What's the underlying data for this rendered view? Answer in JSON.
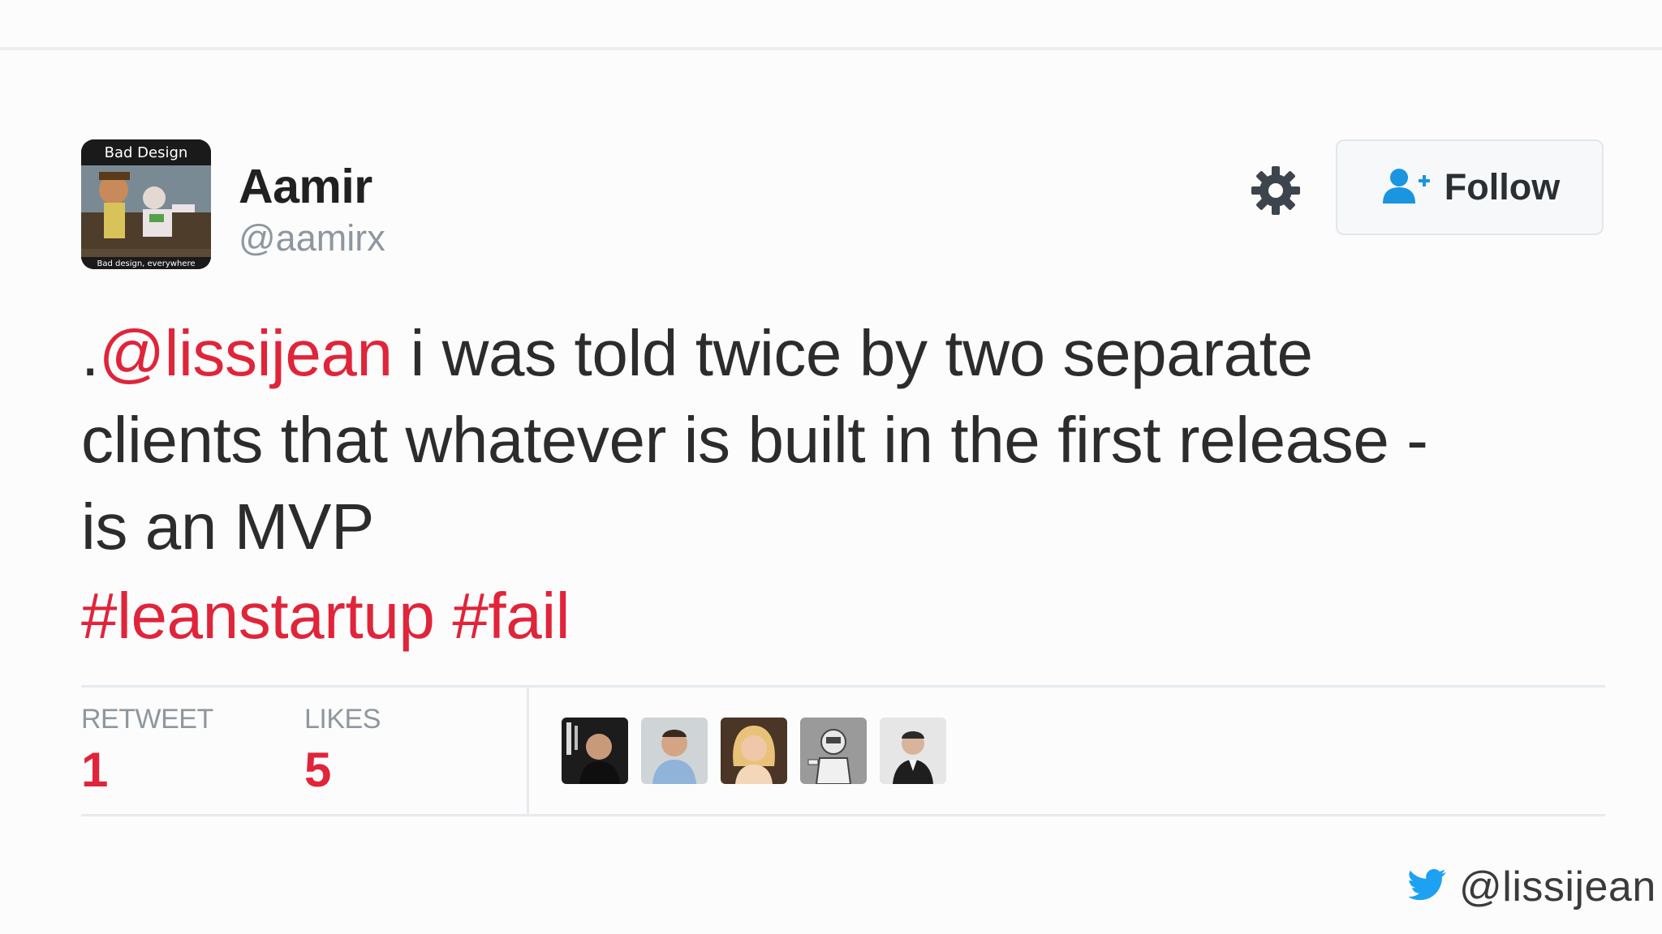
{
  "author": {
    "avatar_caption_top": "Bad Design",
    "avatar_caption_bottom": "Bad design, everywhere",
    "name": "Aamir",
    "handle": "@aamirx"
  },
  "actions": {
    "settings_icon": "gear-icon",
    "follow_icon": "add-user-icon",
    "follow_label": "Follow"
  },
  "tweet": {
    "prefix": ".",
    "mention": "@lissijean",
    "line1_rest": " i was told twice by two separate",
    "line2": "clients that whatever is built in the first release -",
    "line3": "is an MVP",
    "hashtags": [
      "#leanstartup",
      "#fail"
    ]
  },
  "stats": {
    "retweet_label": "RETWEET",
    "retweet_value": "1",
    "likes_label": "LIKES",
    "likes_value": "5"
  },
  "likers_count_shown": 5,
  "credit": {
    "icon": "twitter-bird-icon",
    "handle": "@lissijean"
  },
  "colors": {
    "accent_link": "#e0243a",
    "twitter_blue": "#1da1f2",
    "follow_icon": "#1b95e0",
    "muted_text": "#8e979f"
  }
}
